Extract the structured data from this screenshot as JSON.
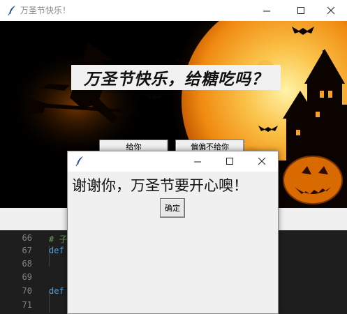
{
  "main_window": {
    "title": "万圣节快乐！",
    "question": "万圣节快乐，给糖吃吗？",
    "buttons": {
      "give": "给你",
      "refuse": "偏偏不给你"
    }
  },
  "dialog": {
    "message": "谢谢你，万圣节要开心噢！",
    "ok_label": "确定"
  },
  "editor": {
    "lines": [
      {
        "num": "66",
        "code": "# 子",
        "color": "#6a9955"
      },
      {
        "num": "67",
        "code": "def",
        "color": "#569cd6"
      },
      {
        "num": "68",
        "code": "",
        "color": "#d4d4d4"
      },
      {
        "num": "69",
        "code": "",
        "color": "#d4d4d4"
      },
      {
        "num": "70",
        "code": "def",
        "color": "#569cd6"
      },
      {
        "num": "71",
        "code": "",
        "color": "#d4d4d4"
      }
    ]
  },
  "colors": {
    "moon": "#f7a21a",
    "sky": "#000000",
    "window_bg": "#f0f0f0"
  }
}
